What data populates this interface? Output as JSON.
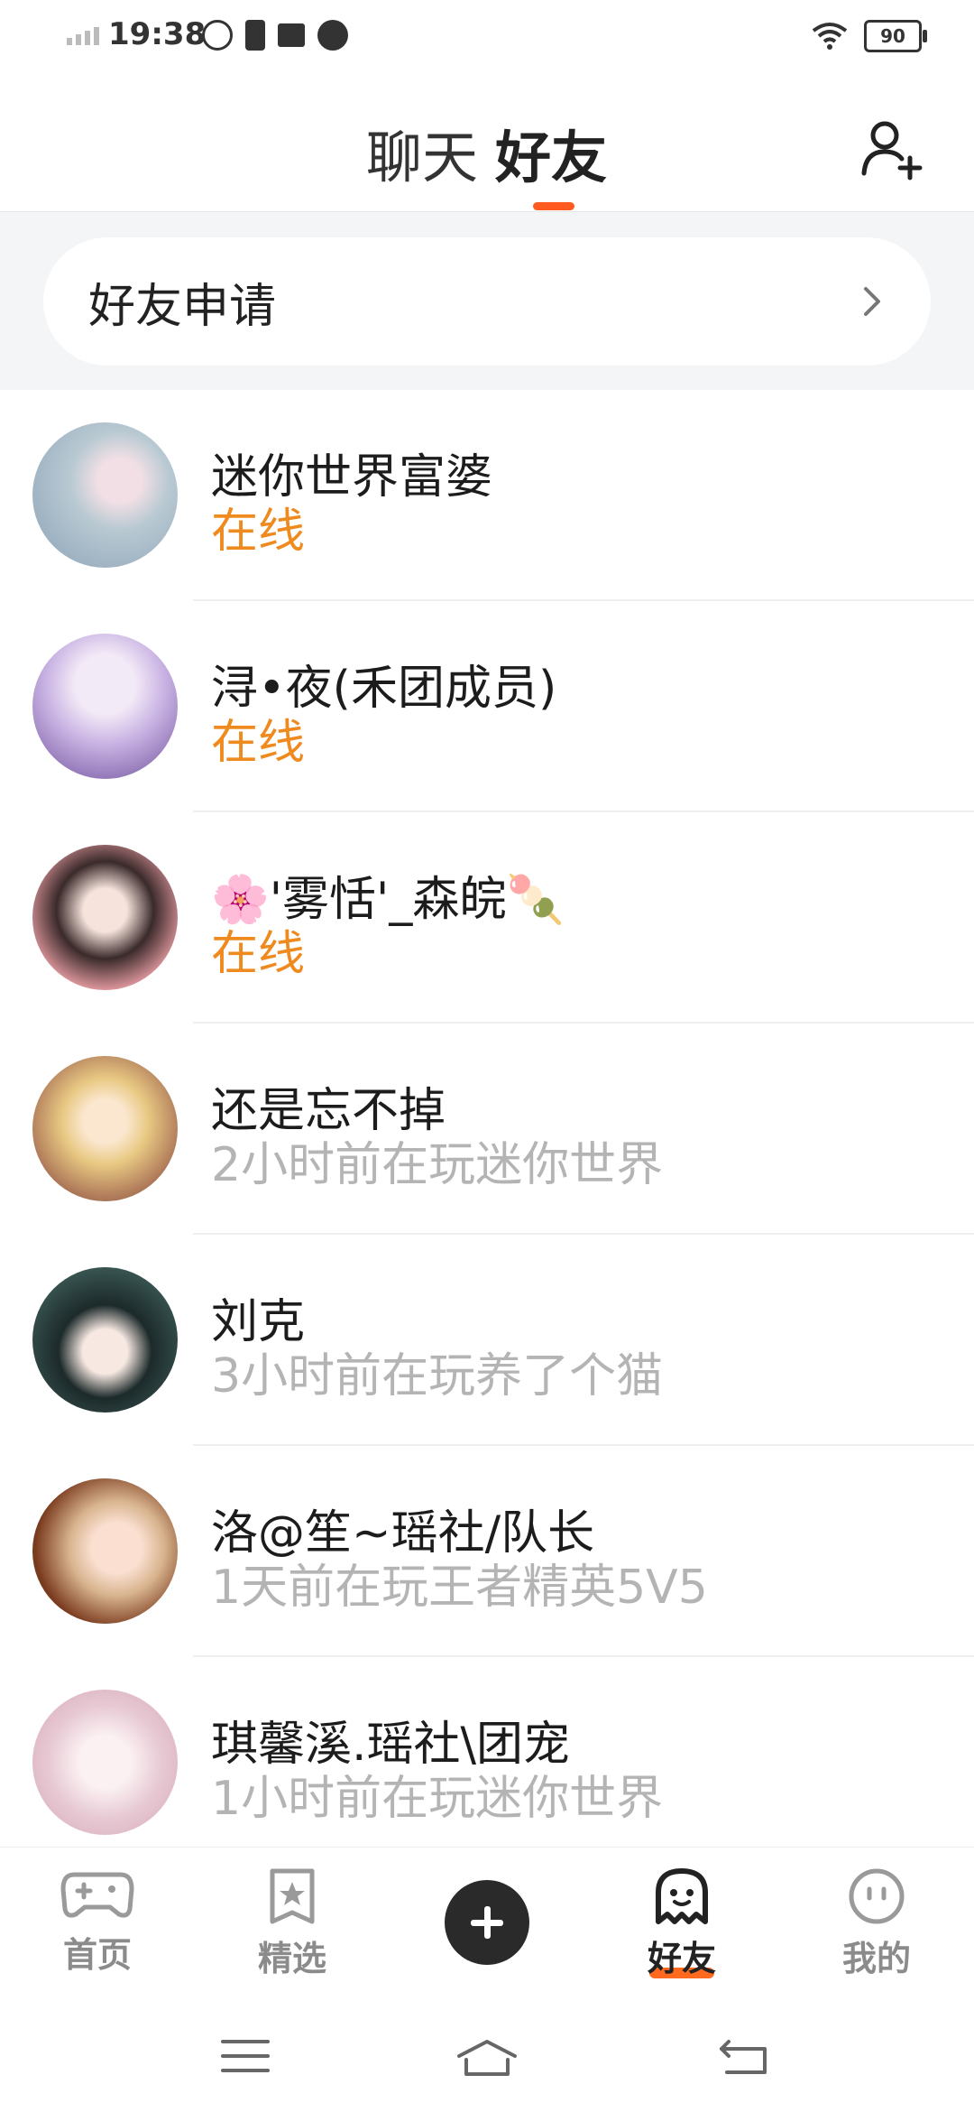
{
  "status_bar": {
    "time": "19:38",
    "battery": "90"
  },
  "header": {
    "tabs": [
      {
        "label": "聊天"
      },
      {
        "label": "好友"
      }
    ],
    "active_tab": "好友"
  },
  "friend_request": {
    "label": "好友申请"
  },
  "friends": [
    {
      "name": "迷你世界富婆",
      "status": "在线",
      "online": true,
      "avatar_color": "#c7d5dc"
    },
    {
      "name": "浔•夜(禾团成员)",
      "status": "在线",
      "online": true,
      "avatar_color": "#a891c9"
    },
    {
      "name": "🌸'雾恬'_森皖🍡",
      "status": "在线",
      "online": true,
      "avatar_color": "#e7a6a9"
    },
    {
      "name": "还是忘不掉",
      "status": "2小时前在玩迷你世界",
      "online": false,
      "avatar_color": "#e6c9a5"
    },
    {
      "name": "刘克",
      "status": "3小时前在玩养了个猫",
      "online": false,
      "avatar_color": "#2f3d3c"
    },
    {
      "name": "洛@笙~瑶社/队长",
      "status": "1天前在玩王者精英5V5",
      "online": false,
      "avatar_color": "#b9683d"
    },
    {
      "name": "琪馨溪.瑶社\\团宠",
      "status": "1小时前在玩迷你世界",
      "online": false,
      "avatar_color": "#f1dce2"
    }
  ],
  "bottom_nav": [
    {
      "label": "首页",
      "icon": "gamepad-icon"
    },
    {
      "label": "精选",
      "icon": "star-bookmark-icon"
    },
    {
      "label": "",
      "icon": "plus-icon"
    },
    {
      "label": "好友",
      "icon": "ghost-icon",
      "active": true
    },
    {
      "label": "我的",
      "icon": "smiley-icon"
    }
  ],
  "colors": {
    "accent": "#ff5a1f",
    "online": "#ef8a1f",
    "offline": "#b4b4b4"
  }
}
